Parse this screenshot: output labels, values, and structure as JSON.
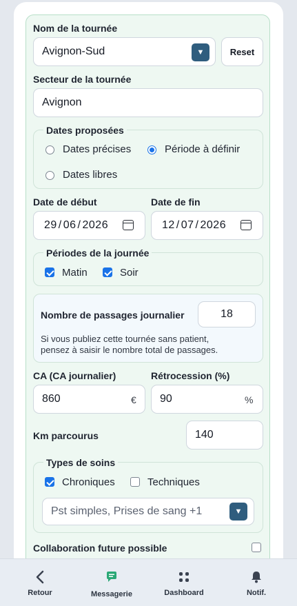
{
  "tournee": {
    "name_label": "Nom de la tournée",
    "name_value": "Avignon-Sud",
    "reset_label": "Reset",
    "secteur_label": "Secteur de la tournée",
    "secteur_value": "Avignon"
  },
  "dates": {
    "legend": "Dates proposées",
    "options": [
      {
        "label": "Dates précises",
        "selected": false
      },
      {
        "label": "Période à définir",
        "selected": true
      },
      {
        "label": "Dates libres",
        "selected": false
      }
    ],
    "start_label": "Date de début",
    "start": {
      "d": "29",
      "m": "06",
      "y": "2026"
    },
    "end_label": "Date de fin",
    "end": {
      "d": "12",
      "m": "07",
      "y": "2026"
    },
    "sep": "/"
  },
  "periodes": {
    "legend": "Périodes de la journée",
    "options": [
      {
        "label": "Matin",
        "checked": true
      },
      {
        "label": "Soir",
        "checked": true
      }
    ]
  },
  "passages": {
    "label": "Nombre de passages journalier",
    "value": "18",
    "note_line1": "Si vous publiez cette tournée sans patient,",
    "note_line2": "pensez à saisir le nombre total de passages."
  },
  "ca": {
    "label": "CA (CA journalier)",
    "value": "860",
    "unit": "€"
  },
  "retro": {
    "label": "Rétrocession (%)",
    "value": "90",
    "unit": "%"
  },
  "km": {
    "label": "Km parcourus",
    "value": "140"
  },
  "soins": {
    "legend": "Types de soins",
    "options": [
      {
        "label": "Chroniques",
        "checked": true
      },
      {
        "label": "Techniques",
        "checked": false
      }
    ],
    "select_value": "Pst simples, Prises de sang +1"
  },
  "collab": {
    "label": "Collaboration future possible",
    "checked": false
  },
  "nav": [
    {
      "label": "Retour",
      "icon": "back-arrow-icon"
    },
    {
      "label": "Messagerie",
      "icon": "chat-icon"
    },
    {
      "label": "Dashboard",
      "icon": "grid-icon"
    },
    {
      "label": "Notif.",
      "icon": "bell-icon"
    }
  ],
  "colors": {
    "accent": "#2f5d7e",
    "form_bg": "#eef8f2",
    "form_border": "#b7dfc8",
    "selection": "#1a73e8"
  }
}
